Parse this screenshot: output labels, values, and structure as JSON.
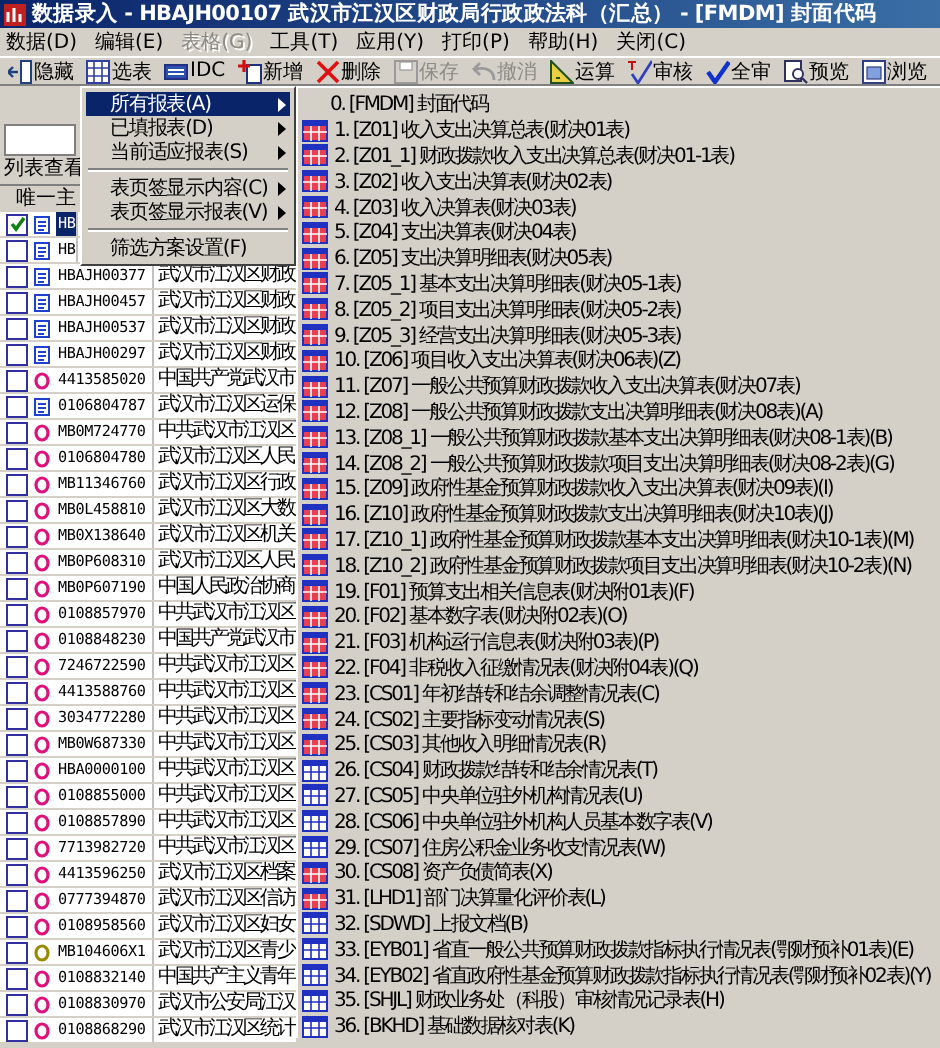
{
  "window": {
    "title": "数据录入 - HBAJH00107  武汉市江汉区财政局行政政法科（汇总） - [FMDM] 封面代码"
  },
  "menu_bar": [
    {
      "label": "数据(D)",
      "disabled": false
    },
    {
      "label": "编辑(E)",
      "disabled": false
    },
    {
      "label": "表格(G)",
      "disabled": true
    },
    {
      "label": "工具(T)",
      "disabled": false
    },
    {
      "label": "应用(Y)",
      "disabled": false
    },
    {
      "label": "打印(P)",
      "disabled": false
    },
    {
      "label": "帮助(H)",
      "disabled": false
    },
    {
      "label": "关闭(C)",
      "disabled": false
    }
  ],
  "toolbar": [
    {
      "label": "隐藏",
      "disabled": false
    },
    {
      "label": "选表",
      "disabled": false
    },
    {
      "label": "IDC",
      "disabled": false
    },
    {
      "label": "新增",
      "disabled": false
    },
    {
      "label": "删除",
      "disabled": false
    },
    {
      "label": "保存",
      "disabled": true
    },
    {
      "label": "撤消",
      "disabled": true
    },
    {
      "label": "运算",
      "disabled": false
    },
    {
      "label": "审核",
      "disabled": false
    },
    {
      "label": "全审",
      "disabled": false
    },
    {
      "label": "预览",
      "disabled": false
    },
    {
      "label": "浏览",
      "disabled": false
    }
  ],
  "list_panel": {
    "label": "列表查看",
    "column_header": "唯一主",
    "rows": [
      {
        "code": "HB",
        "kind": "doc",
        "checked": true,
        "selected": true
      },
      {
        "code": "HB",
        "kind": "doc",
        "checked": false,
        "selected": false
      },
      {
        "code": "HBAJH00377",
        "name": "武汉市江汉区财政",
        "kind": "doc",
        "checked": false,
        "selected": false
      },
      {
        "code": "HBAJH00457",
        "name": "武汉市江汉区财政",
        "kind": "doc",
        "checked": false,
        "selected": false
      },
      {
        "code": "HBAJH00537",
        "name": "武汉市江汉区财政",
        "kind": "doc",
        "checked": false,
        "selected": false
      },
      {
        "code": "HBAJH00297",
        "name": "武汉市江汉区财政",
        "kind": "doc",
        "checked": false,
        "selected": false
      },
      {
        "code": "4413585020",
        "name": "中国共产党武汉市",
        "kind": "ring",
        "color": "#e0107a",
        "checked": false,
        "selected": false
      },
      {
        "code": "0106804787",
        "name": "武汉市江汉区运保",
        "kind": "doc",
        "checked": false,
        "selected": false
      },
      {
        "code": "MB0M724770",
        "name": "中共武汉市江汉区",
        "kind": "ring",
        "color": "#e0107a",
        "checked": false,
        "selected": false
      },
      {
        "code": "0106804780",
        "name": "武汉市江汉区人民",
        "kind": "ring",
        "color": "#e0107a",
        "checked": false,
        "selected": false
      },
      {
        "code": "MB11346760",
        "name": "武汉市江汉区行政",
        "kind": "ring",
        "color": "#e0107a",
        "checked": false,
        "selected": false
      },
      {
        "code": "MB0L458810",
        "name": "武汉市江汉区大数",
        "kind": "ring",
        "color": "#e0107a",
        "checked": false,
        "selected": false
      },
      {
        "code": "MB0X138640",
        "name": "武汉市江汉区机关",
        "kind": "ring",
        "color": "#e0107a",
        "checked": false,
        "selected": false
      },
      {
        "code": "MB0P608310",
        "name": "武汉市江汉区人民",
        "kind": "ring",
        "color": "#e0107a",
        "checked": false,
        "selected": false
      },
      {
        "code": "MB0P607190",
        "name": "中国人民政治协商",
        "kind": "ring",
        "color": "#e0107a",
        "checked": false,
        "selected": false
      },
      {
        "code": "0108857970",
        "name": "中共武汉市江汉区",
        "kind": "ring",
        "color": "#e0107a",
        "checked": false,
        "selected": false
      },
      {
        "code": "0108848230",
        "name": "中国共产党武汉市",
        "kind": "ring",
        "color": "#e0107a",
        "checked": false,
        "selected": false
      },
      {
        "code": "7246722590",
        "name": "中共武汉市江汉区",
        "kind": "ring",
        "color": "#e0107a",
        "checked": false,
        "selected": false
      },
      {
        "code": "4413588760",
        "name": "中共武汉市江汉区",
        "kind": "ring",
        "color": "#e0107a",
        "checked": false,
        "selected": false
      },
      {
        "code": "3034772280",
        "name": "中共武汉市江汉区",
        "kind": "ring",
        "color": "#e0107a",
        "checked": false,
        "selected": false
      },
      {
        "code": "MB0W687330",
        "name": "中共武汉市江汉区",
        "kind": "ring",
        "color": "#e0107a",
        "checked": false,
        "selected": false
      },
      {
        "code": "HBA0000100",
        "name": "中共武汉市江汉区",
        "kind": "ring",
        "color": "#e0107a",
        "checked": false,
        "selected": false
      },
      {
        "code": "0108855000",
        "name": "中共武汉市江汉区",
        "kind": "ring",
        "color": "#e0107a",
        "checked": false,
        "selected": false
      },
      {
        "code": "0108857890",
        "name": "中共武汉市江汉区",
        "kind": "ring",
        "color": "#e0107a",
        "checked": false,
        "selected": false
      },
      {
        "code": "7713982720",
        "name": "中共武汉市江汉区",
        "kind": "ring",
        "color": "#e0107a",
        "checked": false,
        "selected": false
      },
      {
        "code": "4413596250",
        "name": "武汉市江汉区档案",
        "kind": "ring",
        "color": "#e0107a",
        "checked": false,
        "selected": false
      },
      {
        "code": "0777394870",
        "name": "武汉市江汉区信访",
        "kind": "ring",
        "color": "#e0107a",
        "checked": false,
        "selected": false
      },
      {
        "code": "0108958560",
        "name": "武汉市江汉区妇女",
        "kind": "ring",
        "color": "#e0107a",
        "checked": false,
        "selected": false
      },
      {
        "code": "MB104606X1",
        "name": "武汉市江汉区青少",
        "kind": "ring",
        "color": "#9a8a00",
        "checked": false,
        "selected": false
      },
      {
        "code": "0108832140",
        "name": "中国共产主义青年",
        "kind": "ring",
        "color": "#e0107a",
        "checked": false,
        "selected": false
      },
      {
        "code": "0108830970",
        "name": "武汉市公安局江汉",
        "kind": "ring",
        "color": "#e0107a",
        "checked": false,
        "selected": false
      },
      {
        "code": "0108868290",
        "name": "武汉市江汉区统计",
        "kind": "ring",
        "color": "#e0107a",
        "checked": false,
        "selected": false
      }
    ]
  },
  "context_menu": {
    "items": [
      {
        "kind": "item",
        "label": "所有报表(A)",
        "selected": true,
        "submenu": true
      },
      {
        "kind": "item",
        "label": "已填报表(D)",
        "selected": false,
        "submenu": true
      },
      {
        "kind": "item",
        "label": "当前适应报表(S)",
        "selected": false,
        "submenu": true
      },
      {
        "kind": "separator"
      },
      {
        "kind": "item",
        "label": "表页签显示内容(C)",
        "selected": false,
        "submenu": true
      },
      {
        "kind": "item",
        "label": "表页签显示报表(V)",
        "selected": false,
        "submenu": true
      },
      {
        "kind": "separator"
      },
      {
        "kind": "item",
        "label": "筛选方案设置(F)",
        "selected": false,
        "submenu": false
      }
    ]
  },
  "report_submenu": {
    "items": [
      {
        "label": "0. [FMDM] 封面代码",
        "kind": "none"
      },
      {
        "label": "1. [Z01] 收入支出决算总表(财决01表)",
        "kind": "filled"
      },
      {
        "label": "2. [Z01_1] 财政拨款收入支出决算总表(财决01-1表)",
        "kind": "filled"
      },
      {
        "label": "3. [Z02] 收入支出决算表(财决02表)",
        "kind": "filled"
      },
      {
        "label": "4. [Z03] 收入决算表(财决03表)",
        "kind": "filled"
      },
      {
        "label": "5. [Z04] 支出决算表(财决04表)",
        "kind": "filled"
      },
      {
        "label": "6. [Z05] 支出决算明细表(财决05表)",
        "kind": "filled"
      },
      {
        "label": "7. [Z05_1] 基本支出决算明细表(财决05-1表)",
        "kind": "filled"
      },
      {
        "label": "8. [Z05_2] 项目支出决算明细表(财决05-2表)",
        "kind": "filled"
      },
      {
        "label": "9. [Z05_3] 经营支出决算明细表(财决05-3表)",
        "kind": "filled"
      },
      {
        "label": "10. [Z06] 项目收入支出决算表(财决06表)(Z)",
        "kind": "filled"
      },
      {
        "label": "11. [Z07] 一般公共预算财政拨款收入支出决算表(财决07表)",
        "kind": "filled"
      },
      {
        "label": "12. [Z08] 一般公共预算财政拨款支出决算明细表(财决08表)(A)",
        "kind": "filled"
      },
      {
        "label": "13. [Z08_1] 一般公共预算财政拨款基本支出决算明细表(财决08-1表)(B)",
        "kind": "filled"
      },
      {
        "label": "14. [Z08_2] 一般公共预算财政拨款项目支出决算明细表(财决08-2表)(G)",
        "kind": "filled"
      },
      {
        "label": "15. [Z09] 政府性基金预算财政拨款收入支出决算表(财决09表)(I)",
        "kind": "filled"
      },
      {
        "label": "16. [Z10] 政府性基金预算财政拨款支出决算明细表(财决10表)(J)",
        "kind": "filled"
      },
      {
        "label": "17. [Z10_1] 政府性基金预算财政拨款基本支出决算明细表(财决10-1表)(M)",
        "kind": "filled"
      },
      {
        "label": "18. [Z10_2] 政府性基金预算财政拨款项目支出决算明细表(财决10-2表)(N)",
        "kind": "filled"
      },
      {
        "label": "19. [F01] 预算支出相关信息表(财决附01表)(F)",
        "kind": "filled"
      },
      {
        "label": "20. [F02] 基本数字表(财决附02表)(O)",
        "kind": "filled"
      },
      {
        "label": "21. [F03] 机构运行信息表(财决附03表)(P)",
        "kind": "filled"
      },
      {
        "label": "22. [F04] 非税收入征缴情况表(财决附04表)(Q)",
        "kind": "filled"
      },
      {
        "label": "23. [CS01] 年初结转和结余调整情况表(C)",
        "kind": "filled"
      },
      {
        "label": "24. [CS02] 主要指标变动情况表(S)",
        "kind": "filled"
      },
      {
        "label": "25. [CS03] 其他收入明细情况表(R)",
        "kind": "filled"
      },
      {
        "label": "26. [CS04] 财政拨款结转和结余情况表(T)",
        "kind": "plain"
      },
      {
        "label": "27. [CS05] 中央单位驻外机构情况表(U)",
        "kind": "plain"
      },
      {
        "label": "28. [CS06] 中央单位驻外机构人员基本数字表(V)",
        "kind": "plain"
      },
      {
        "label": "29. [CS07] 住房公积金业务收支情况表(W)",
        "kind": "plain"
      },
      {
        "label": "30. [CS08] 资产负债简表(X)",
        "kind": "filled"
      },
      {
        "label": "31. [LHD1] 部门决算量化评价表(L)",
        "kind": "filled"
      },
      {
        "label": "32. [SDWD] 上报文档(B)",
        "kind": "plain"
      },
      {
        "label": "33. [EYB01] 省直一般公共预算财政拨款指标执行情况表(鄂财预补01表)(E)",
        "kind": "plain"
      },
      {
        "label": "34. [EYB02] 省直政府性基金预算财政拨款指标执行情况表(鄂财预补02表)(Y)",
        "kind": "plain"
      },
      {
        "label": "35. [SHJL] 财政业务处（科股）审核情况记录表(H)",
        "kind": "plain"
      },
      {
        "label": "36. [BKHD] 基础数据核对表(K)",
        "kind": "plain"
      }
    ]
  }
}
